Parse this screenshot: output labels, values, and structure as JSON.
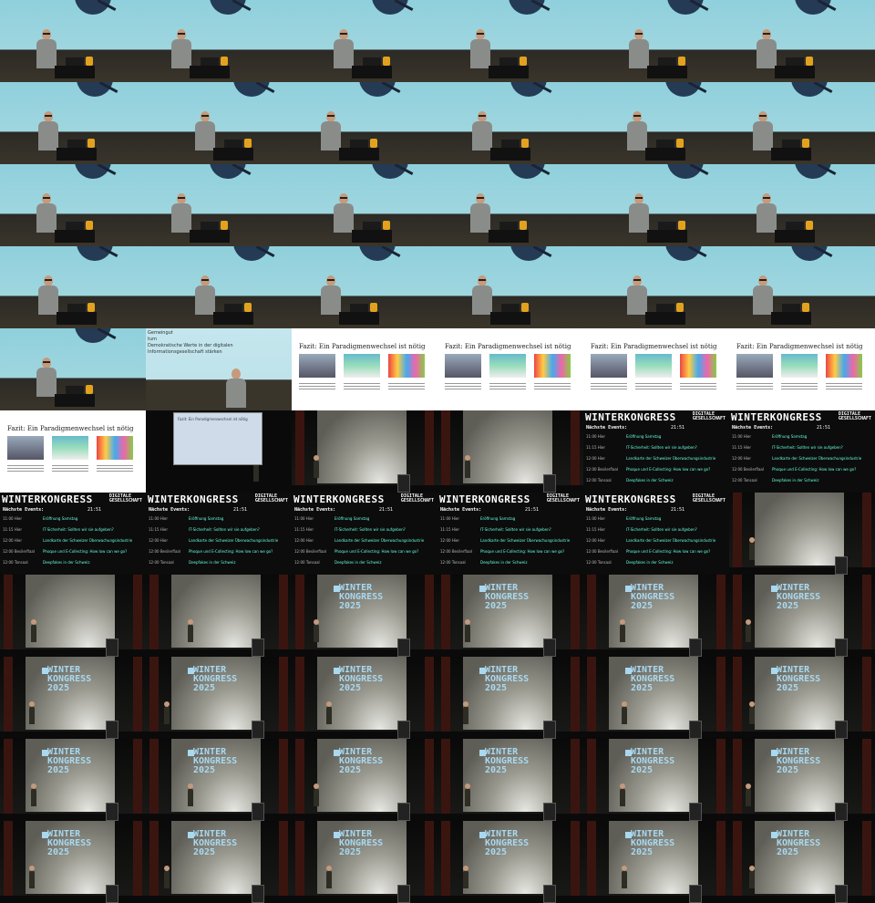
{
  "contact_sheet": {
    "columns": 6,
    "rows": 11,
    "slide_title": "Fazit: Ein Paradigmenwechsel ist nötig",
    "mixed_slide_text": [
      "Gemeingut",
      "tum",
      "Demokratische Werte in der digitalen",
      "Informationsgesellschaft stärken"
    ],
    "board": {
      "brand": "WINTERKONGRESS",
      "brand_right": [
        "DIGITALE",
        "GESELLSCHAFT"
      ],
      "subtitle": "Nächste Events:",
      "time": "21:51",
      "rows": [
        {
          "time": "11:00",
          "room": "Hier",
          "event": "Eröffnung Samstag"
        },
        {
          "time": "11:15",
          "room": "Hier",
          "event": "IT-Sicherheit: Sollten wir sie aufgeben?"
        },
        {
          "time": "12:00",
          "room": "Hier",
          "event": "Landkarte der Schweizer Überwachungsindustrie"
        },
        {
          "time": "12:00",
          "room": "Besilerflaal",
          "event": "Phoque und E-Collecting: How low can we go?"
        },
        {
          "time": "12:00",
          "room": "Tonsaal",
          "event": "Deepfakes in der Schweiz"
        }
      ]
    },
    "hall_logo": [
      "WINTER",
      "KONGRESS",
      "2025"
    ]
  }
}
